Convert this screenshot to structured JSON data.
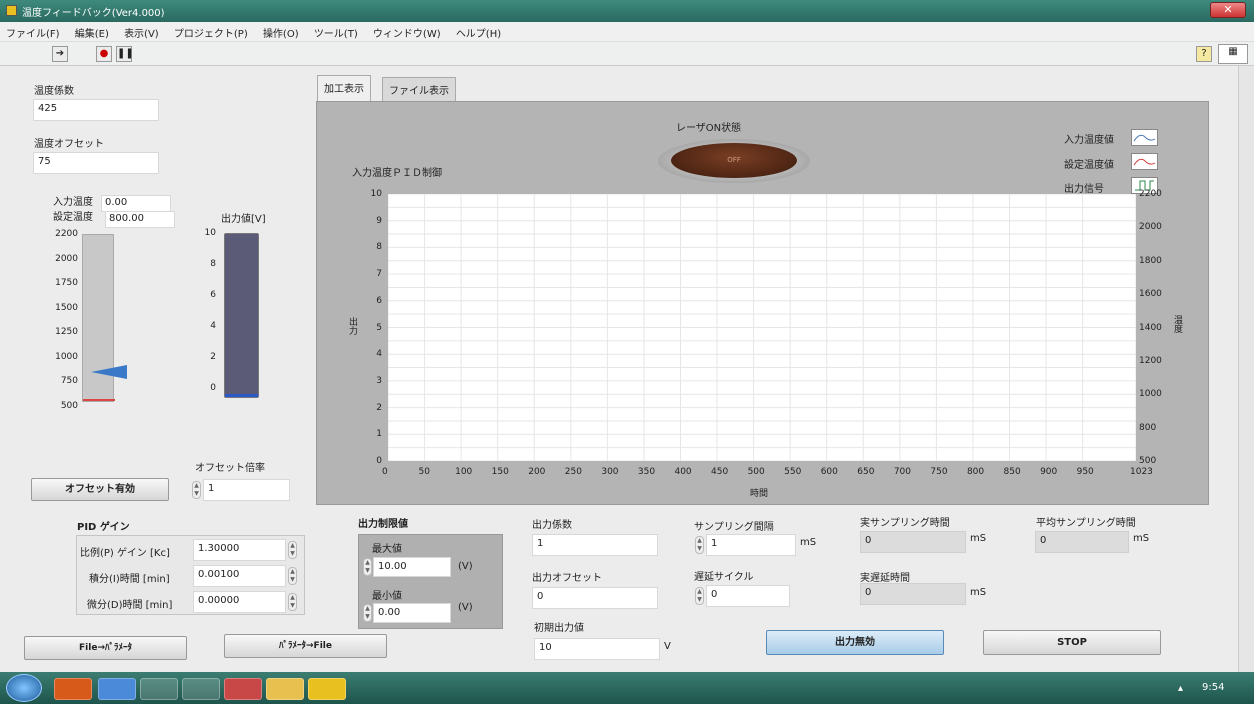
{
  "window": {
    "title": "温度フィードバック(Ver4.000)"
  },
  "menu": [
    "ファイル(F)",
    "編集(E)",
    "表示(V)",
    "プロジェクト(P)",
    "操作(O)",
    "ツール(T)",
    "ウィンドウ(W)",
    "ヘルプ(H)"
  ],
  "left": {
    "temp_coef_label": "温度係数",
    "temp_coef_value": "425",
    "temp_offset_label": "温度オフセット",
    "temp_offset_value": "75",
    "input_temp_label": "入力温度",
    "input_temp_value": "0.00",
    "set_temp_label": "設定温度",
    "set_temp_value": "800.00",
    "thermo_ticks": [
      "2200",
      "2000",
      "1750",
      "1500",
      "1250",
      "1000",
      "750",
      "500"
    ],
    "output_value_label": "出力値[V]",
    "output_ticks": [
      "10",
      "8",
      "6",
      "4",
      "2",
      "0"
    ],
    "output_level": 0,
    "set_temp_level": 800,
    "offset_enable_button": "オフセット有効",
    "offset_ratio_label": "オフセット倍率",
    "offset_ratio_value": "1"
  },
  "pid": {
    "title": "PID ゲイン",
    "rows": [
      {
        "label": "比例(P) ゲイン [Kc]",
        "value": "1.30000"
      },
      {
        "label": "積分(I)時間 [min]",
        "value": "0.00100"
      },
      {
        "label": "微分(D)時間 [min]",
        "value": "0.00000"
      }
    ]
  },
  "buttons": {
    "file_to_param": "File→ﾊﾟﾗﾒｰﾀ",
    "param_to_file": "ﾊﾟﾗﾒｰﾀ→File",
    "output_disable": "出力無効",
    "stop": "STOP"
  },
  "output_limit": {
    "title": "出力制限値",
    "max_label": "最大値",
    "max_value": "10.00",
    "min_label": "最小値",
    "min_value": "0.00",
    "unit": "(V)"
  },
  "output_params": {
    "coef_label": "出力係数",
    "coef_value": "1",
    "offset_label": "出力オフセット",
    "offset_value": "0",
    "initial_label": "初期出力値",
    "initial_value": "10",
    "initial_unit": "V"
  },
  "sampling": {
    "interval_label": "サンプリング間隔",
    "interval_value": "1",
    "interval_unit": "mS",
    "delay_label": "遅延サイクル",
    "delay_value": "0",
    "actual_label": "実サンプリング時間",
    "actual_value": "0",
    "actual_unit": "mS",
    "actual_delay_label": "実遅延時間",
    "actual_delay_value": "0",
    "actual_delay_unit": "mS",
    "avg_label": "平均サンプリング時間",
    "avg_value": "0",
    "avg_unit": "mS"
  },
  "tabs": [
    "加工表示",
    "ファイル表示"
  ],
  "chart_section": {
    "laser_label": "レーザON状態",
    "laser_state": "OFF",
    "title": "入力温度ＰＩＤ制御",
    "legend": [
      {
        "name": "入力温度値",
        "color": "#4a7ab8"
      },
      {
        "name": "設定温度値",
        "color": "#d04040"
      },
      {
        "name": "出力信号",
        "color": "#2a8a4a"
      }
    ]
  },
  "chart_data": {
    "type": "line",
    "title": "入力温度ＰＩＤ制御",
    "xlabel": "時間",
    "ylabel": "出力",
    "y2label": "温度",
    "xlim": [
      0,
      1023
    ],
    "ylim": [
      0,
      10
    ],
    "y2lim": [
      500,
      2200
    ],
    "x_ticks": [
      "0",
      "50",
      "100",
      "150",
      "200",
      "250",
      "300",
      "350",
      "400",
      "450",
      "500",
      "550",
      "600",
      "650",
      "700",
      "750",
      "800",
      "850",
      "900",
      "950",
      "1023"
    ],
    "y_ticks": [
      "10",
      "9",
      "8",
      "7",
      "6",
      "5",
      "4",
      "3",
      "2",
      "1",
      "0"
    ],
    "y2_ticks": [
      "2200",
      "2000",
      "1800",
      "1600",
      "1400",
      "1200",
      "1000",
      "800",
      "500"
    ],
    "grid": true,
    "series": [
      {
        "name": "入力温度値",
        "values": []
      },
      {
        "name": "設定温度値",
        "values": []
      },
      {
        "name": "出力信号",
        "values": []
      }
    ]
  },
  "taskbar": {
    "clock": "9:54"
  }
}
